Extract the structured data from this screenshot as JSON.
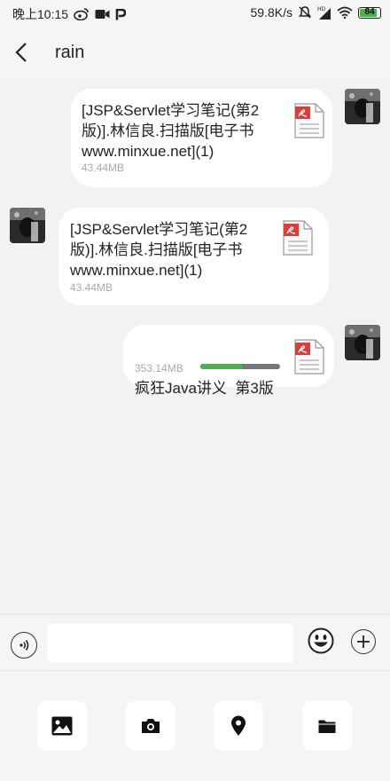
{
  "status_bar": {
    "time": "晚上10:15",
    "left_icons": [
      "weibo-icon",
      "video-camera-icon",
      "p-app-icon"
    ],
    "network_speed": "59.8K/s",
    "right_icons": [
      "mute-icon",
      "hd-signal-icon",
      "wifi-icon"
    ],
    "battery": "84",
    "battery_level": 0.84
  },
  "header": {
    "back_icon": "back-arrow-icon",
    "title": "rain"
  },
  "messages": [
    {
      "side": "right",
      "type": "file",
      "icon": "pdf-file-icon",
      "name_lines": [
        "[JSP&Servlet学习笔记(第2",
        "版)].林信良.扫描版[电子书",
        "www.minxue.net](1)"
      ],
      "size": "43.44MB"
    },
    {
      "side": "left",
      "type": "file",
      "icon": "pdf-file-icon",
      "name_lines": [
        "[JSP&Servlet学习笔记(第2",
        "版)].林信良.扫描版[电子书",
        "www.minxue.net](1)"
      ],
      "size": "43.44MB"
    },
    {
      "side": "right",
      "type": "file",
      "icon": "pdf-file-icon",
      "name_lines": [
        "疯狂Java讲义  第3版"
      ],
      "size": "353.14MB",
      "progress": 0.52
    }
  ],
  "input_bar": {
    "voice_icon": "voice-icon",
    "placeholder": "",
    "emoji_icon": "emoji-icon",
    "plus_icon": "plus-icon"
  },
  "panel": {
    "buttons": [
      "image-icon",
      "camera-icon",
      "location-icon",
      "folder-icon"
    ]
  },
  "colors": {
    "accent_green": "#4caf50",
    "pdf_red": "#e53935",
    "background": "#f2f2f2"
  }
}
